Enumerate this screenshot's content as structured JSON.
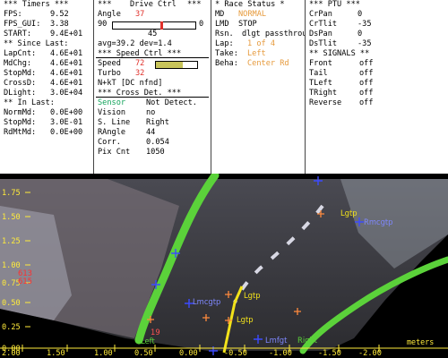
{
  "timers": {
    "header": "*** Timers ***",
    "fps_label": "FPS:",
    "fps": "9.52",
    "fps_gui_label": "FPS_GUI:",
    "fps_gui": "3.38",
    "start_label": "START:",
    "start": "9.4E+01",
    "since_header": "** Since Last:",
    "since": [
      {
        "label": "LapCnt:",
        "value": "4.6E+01"
      },
      {
        "label": "MdChg:",
        "value": "4.6E+01"
      },
      {
        "label": "StopMd:",
        "value": "4.6E+01"
      },
      {
        "label": "CrossD:",
        "value": "4.6E+01"
      },
      {
        "label": "DLight:",
        "value": "3.0E+04"
      }
    ],
    "inlast_header": "** In Last:",
    "inlast": [
      {
        "label": "NormMd:",
        "value": "0.0E+00"
      },
      {
        "label": "StopMd:",
        "value": "3.0E-01"
      },
      {
        "label": "RdMtMd:",
        "value": "0.0E+00"
      }
    ]
  },
  "drive": {
    "header_left": "***",
    "header_title": "Drive Ctrl",
    "header_right": "***",
    "angle_label": "Angle",
    "angle": "37",
    "scale_left": "90",
    "scale_right": "0",
    "angle_fraction": 0.59,
    "below_value": "45",
    "stats": "avg=39.2  dev=1.4",
    "speed_header": "***  Speed Ctrl  ***",
    "speed_label": "Speed",
    "speed": "72",
    "speed_fraction": 0.65,
    "turbo_label": "Turbo",
    "turbo": "32",
    "nkt": "N+kT [DC nfnd]",
    "cross_header": "*** Cross Det. ***",
    "cross": [
      {
        "label": "Sensor",
        "value": "Not Detect."
      },
      {
        "label": "Vision",
        "value": "no"
      },
      {
        "label": "S. Line",
        "value": "Right"
      },
      {
        "label": "RAngle",
        "value": "44"
      },
      {
        "label": "Corr.",
        "value": "0.054"
      },
      {
        "label": "Pix Cnt",
        "value": "1050"
      }
    ]
  },
  "race": {
    "header": "* Race Status *",
    "md_label": "MD",
    "md": "NORMAL",
    "lmd_label": "LMD",
    "lmd": "STOP",
    "rsn_label": "Rsn.",
    "rsn": "dlgt passthroug",
    "lap_label": "Lap:",
    "lap": "1 of 4",
    "take_label": "Take:",
    "take": "Left",
    "beha_label": "Beha:",
    "beha": "Center Rd"
  },
  "ptu": {
    "header": "*** PTU ***",
    "items": [
      {
        "label": "CrPan",
        "value": "0"
      },
      {
        "label": "CrTlit",
        "value": "-35"
      },
      {
        "label": "DsPan",
        "value": "0"
      },
      {
        "label": "DsTlit",
        "value": "-35"
      }
    ],
    "signals_header": "** SIGNALS **",
    "signals": [
      {
        "label": "Front",
        "value": "off"
      },
      {
        "label": "Tail",
        "value": "off"
      },
      {
        "label": "TLeft",
        "value": "off"
      },
      {
        "label": "TRight",
        "value": "off"
      },
      {
        "label": "Reverse",
        "value": "off"
      }
    ]
  },
  "view": {
    "y_ticks": [
      "1.75",
      "1.50",
      "1.25",
      "1.00",
      "0.75",
      "0.50",
      "0.25",
      "0.00"
    ],
    "x_ticks": [
      "2.00",
      "1.50",
      "1.00",
      "0.50",
      "0.00",
      "-0.50",
      "-1.00",
      "-1.50",
      "-2.00"
    ],
    "x_unit": "meters",
    "labels": {
      "lgtp_top": "Lgtp",
      "rmcgtp": "Rmcgtp",
      "lmcgtp": "Lmcgtp",
      "lgtp_mid": "Lgtp",
      "lgtp_low": "Lgtp",
      "lmfgt": "Lmfgt",
      "right": "Right",
      "left": "Left",
      "t19": "19",
      "n613": "613",
      "n615": "615"
    }
  },
  "colors": {
    "panel_bg": "#ffffff",
    "value_red": "#e0302a",
    "value_orange": "#e69a3c",
    "value_green": "#11a35a",
    "tick_yellow": "#ffeb3b",
    "lane_green": "#5bd23a",
    "marker_blue": "#3c4bff",
    "marker_orange": "#ff8a3d"
  }
}
